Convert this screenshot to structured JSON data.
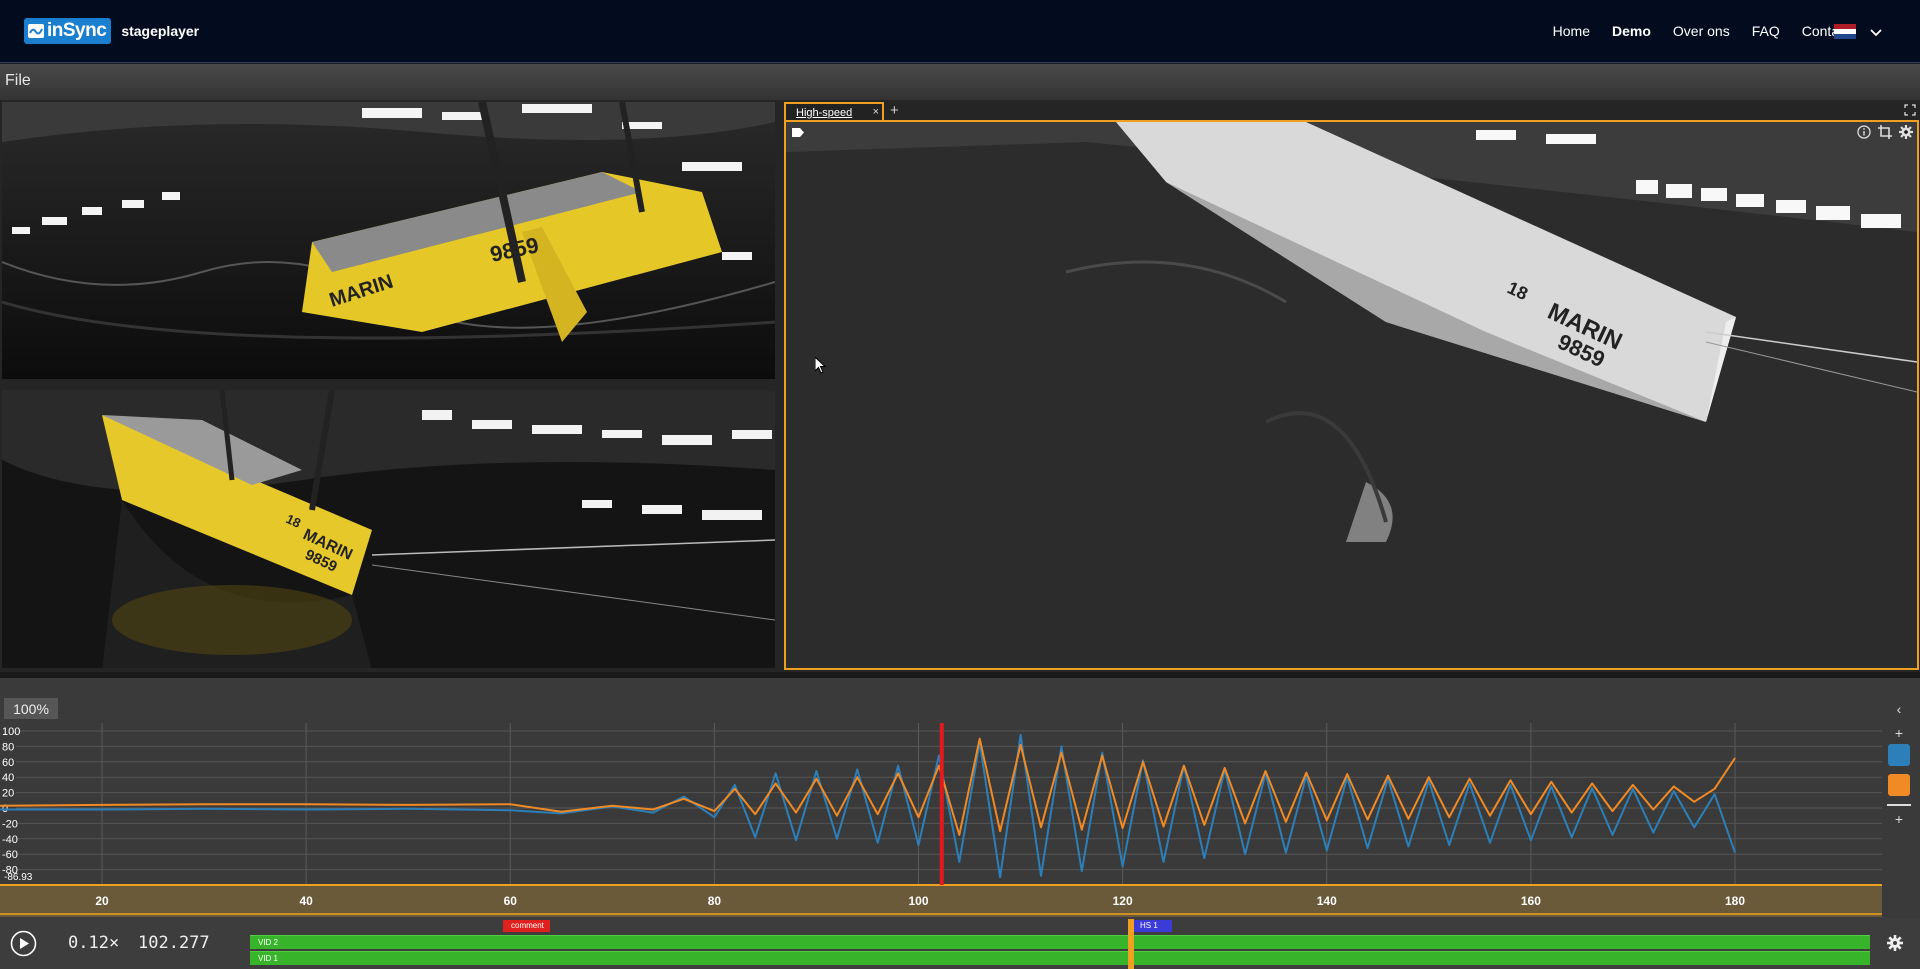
{
  "header": {
    "logo_text": "inSync",
    "logo_sub": "stageplayer",
    "nav": [
      {
        "label": "Home",
        "active": false
      },
      {
        "label": "Demo",
        "active": true
      },
      {
        "label": "Over ons",
        "active": false
      },
      {
        "label": "FAQ",
        "active": false
      },
      {
        "label": "Contact",
        "active": false
      }
    ],
    "language_flag": "netherlands-flag-icon"
  },
  "menubar": {
    "file_label": "File"
  },
  "high_speed_panel": {
    "tab_label": "High-speed",
    "close_label": "×",
    "add_label": "+"
  },
  "video_overlays": {
    "top_left": {
      "hull_text": "MARIN",
      "sail_number": "9859"
    },
    "bottom_left": {
      "hull_text": "MARIN",
      "sail_number": "9859",
      "mark": "18"
    },
    "high_speed": {
      "hull_text": "MARIN",
      "sail_number": "9859",
      "mark": "18"
    }
  },
  "chart": {
    "zoom_label": "100%",
    "current_value_label": "-86.93",
    "colors": {
      "series1": "#2c7fb8",
      "series2": "#f08a24",
      "cursor": "#e31a1c",
      "axis": "#f0a020"
    }
  },
  "chart_data": {
    "type": "line",
    "x_ticks": [
      20,
      40,
      60,
      80,
      100,
      120,
      140,
      160,
      180
    ],
    "y_ticks": [
      100,
      80,
      60,
      40,
      20,
      0,
      -20,
      -40,
      -60,
      -80
    ],
    "xlim": [
      10,
      184
    ],
    "ylim": [
      -86.93,
      100
    ],
    "grid": true,
    "cursor_x": 102.277,
    "series": [
      {
        "color": "#2c7fb8",
        "x": [
          10,
          20,
          30,
          40,
          50,
          60,
          65,
          70,
          74,
          77,
          80,
          82,
          84,
          86,
          88,
          90,
          92,
          94,
          96,
          98,
          100,
          102,
          104,
          106,
          108,
          110,
          112,
          114,
          116,
          118,
          120,
          122,
          124,
          126,
          128,
          130,
          132,
          134,
          136,
          138,
          140,
          142,
          144,
          146,
          148,
          150,
          152,
          154,
          156,
          158,
          160,
          162,
          164,
          166,
          168,
          170,
          172,
          174,
          176,
          178,
          180
        ],
        "y": [
          -2,
          -2,
          -1,
          -2,
          -1,
          -3,
          -7,
          2,
          -6,
          15,
          -12,
          30,
          -38,
          45,
          -42,
          48,
          -40,
          50,
          -45,
          55,
          -48,
          68,
          -70,
          85,
          -90,
          95,
          -88,
          80,
          -82,
          72,
          -76,
          62,
          -70,
          55,
          -65,
          50,
          -60,
          45,
          -58,
          42,
          -55,
          40,
          -52,
          38,
          -50,
          35,
          -48,
          32,
          -45,
          30,
          -42,
          28,
          -38,
          26,
          -35,
          25,
          -32,
          22,
          -25,
          18,
          -58
        ]
      },
      {
        "color": "#f08a24",
        "x": [
          10,
          20,
          30,
          40,
          50,
          60,
          65,
          70,
          74,
          77,
          80,
          82,
          84,
          86,
          88,
          90,
          92,
          94,
          96,
          98,
          100,
          102,
          104,
          106,
          108,
          110,
          112,
          114,
          116,
          118,
          120,
          122,
          124,
          126,
          128,
          130,
          132,
          134,
          136,
          138,
          140,
          142,
          144,
          146,
          148,
          150,
          152,
          154,
          156,
          158,
          160,
          162,
          164,
          166,
          168,
          170,
          172,
          174,
          176,
          178,
          180
        ],
        "y": [
          3,
          4,
          5,
          5,
          4,
          5,
          -5,
          3,
          -2,
          12,
          -4,
          25,
          -8,
          32,
          -6,
          38,
          -10,
          40,
          -8,
          45,
          -12,
          55,
          -35,
          90,
          -30,
          82,
          -25,
          72,
          -28,
          68,
          -26,
          60,
          -24,
          55,
          -22,
          52,
          -20,
          48,
          -18,
          46,
          -16,
          44,
          -15,
          42,
          -14,
          40,
          -12,
          38,
          -10,
          36,
          -8,
          34,
          -6,
          32,
          -4,
          30,
          -2,
          28,
          8,
          25,
          65
        ]
      }
    ]
  },
  "player": {
    "speed": "0.12×",
    "time": "102.277",
    "tracks": [
      {
        "label": "VID 2"
      },
      {
        "label": "VID 1"
      }
    ],
    "markers": [
      {
        "label": "comment",
        "color": "#e0201c"
      },
      {
        "label": "HS 1",
        "color": "#3b3bd8"
      }
    ]
  }
}
